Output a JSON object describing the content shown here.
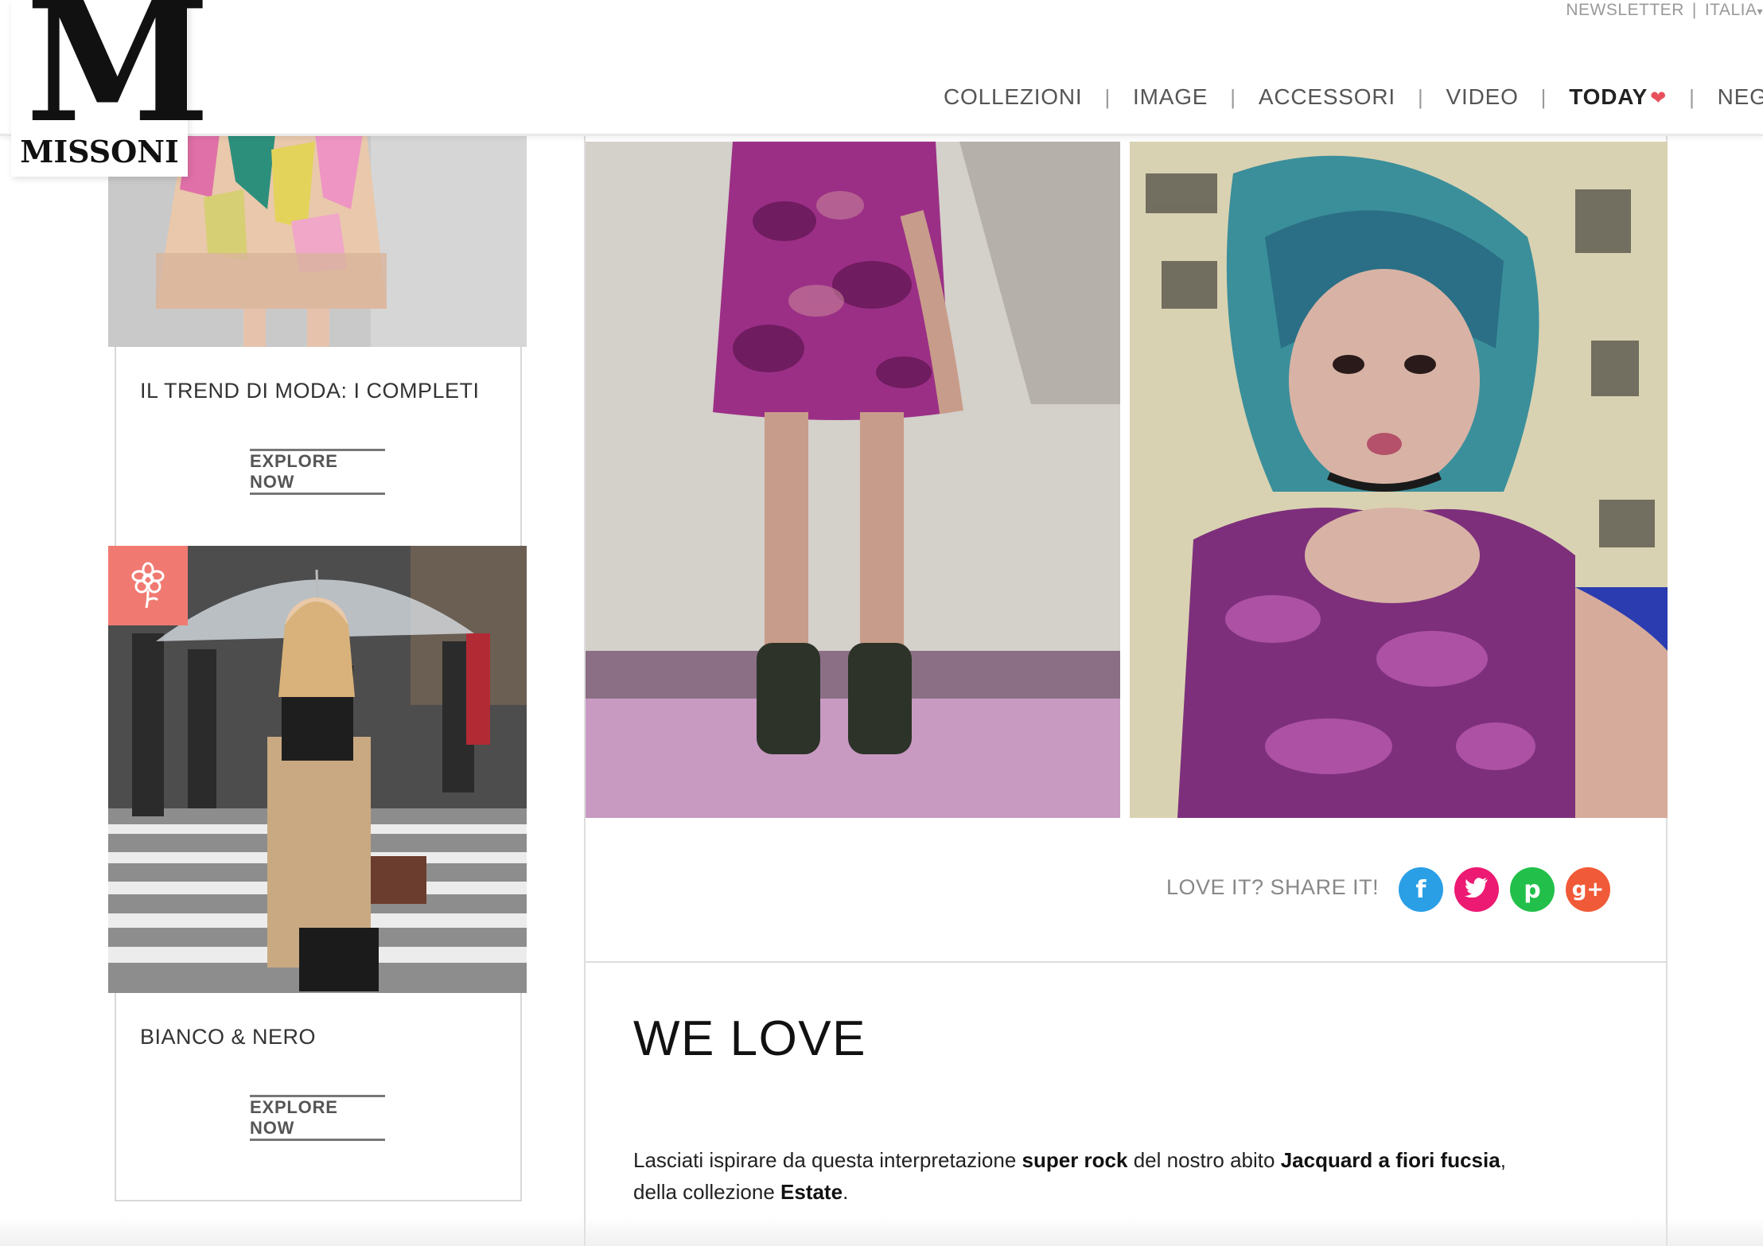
{
  "brand": {
    "logo_letter": "M",
    "logo_word": "MISSONI"
  },
  "topnav": {
    "newsletter": "NEWSLETTER",
    "country": "ITALIA",
    "country_chevron": "chevron-down-icon"
  },
  "mainnav": {
    "items": [
      {
        "label": "COLLEZIONI"
      },
      {
        "label": "IMAGE"
      },
      {
        "label": "ACCESSORI"
      },
      {
        "label": "VIDEO"
      },
      {
        "label": "TODAY"
      },
      {
        "label": "NEGOZI"
      }
    ],
    "today_icon": "heart-icon",
    "heart_color": "#e8505b"
  },
  "sidebar": {
    "cards": [
      {
        "title": "IL TREND DI MODA: I COMPLETI",
        "button": "EXPLORE NOW"
      },
      {
        "title": "BIANCO & NERO",
        "button": "EXPLORE NOW",
        "badge_icon": "flower-icon",
        "badge_color": "#f07a72"
      }
    ]
  },
  "article": {
    "share_label": "LOVE IT? SHARE IT!",
    "social": [
      {
        "name": "facebook-icon",
        "glyph": "f",
        "color": "#2a9fe6"
      },
      {
        "name": "twitter-icon",
        "glyph": "t",
        "color": "#ec1a72"
      },
      {
        "name": "pinterest-icon",
        "glyph": "p",
        "color": "#22c04a"
      },
      {
        "name": "googleplus-icon",
        "glyph": "g+",
        "color": "#f15a38"
      }
    ],
    "title": "WE LOVE",
    "description": {
      "p1": "Lasciati ispirare da questa interpretazione ",
      "b1": "super rock",
      "p2": " del nostro abito ",
      "b2": "Jacquard a fiori fucsia",
      "p3": ",",
      "p4": "della collezione ",
      "b3": "Estate",
      "p5": "."
    }
  }
}
